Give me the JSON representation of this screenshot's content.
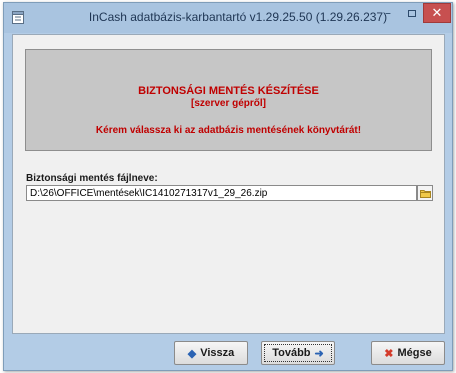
{
  "window": {
    "title": "InCash adatbázis-karbantartó v1.29.25.50 (1.29.26.237)",
    "minimize_symbol": "–",
    "close_symbol": "✕"
  },
  "banner": {
    "line1": "BIZTONSÁGI MENTÉS KÉSZÍTÉSE",
    "line2": "[szerver gépről]",
    "line3": "Kérem válassza ki az adatbázis mentésének könyvtárát!",
    "text_color": "#c00000"
  },
  "file": {
    "label": "Biztonsági mentés fájlneve:",
    "value": "D:\\26\\OFFICE\\mentések\\IC1410271317v1_29_26.zip"
  },
  "buttons": {
    "back_label": "Vissza",
    "back_icon": "arrow-left",
    "back_glyph": "◆",
    "next_label": "Tovább",
    "next_icon": "arrow-right",
    "next_glyph": "➜",
    "cancel_label": "Mégse",
    "cancel_icon": "x-mark",
    "cancel_glyph": "✖"
  },
  "colors": {
    "accent": "#2b63b3",
    "close_button": "#c75050",
    "frame": "#b3cce6"
  }
}
